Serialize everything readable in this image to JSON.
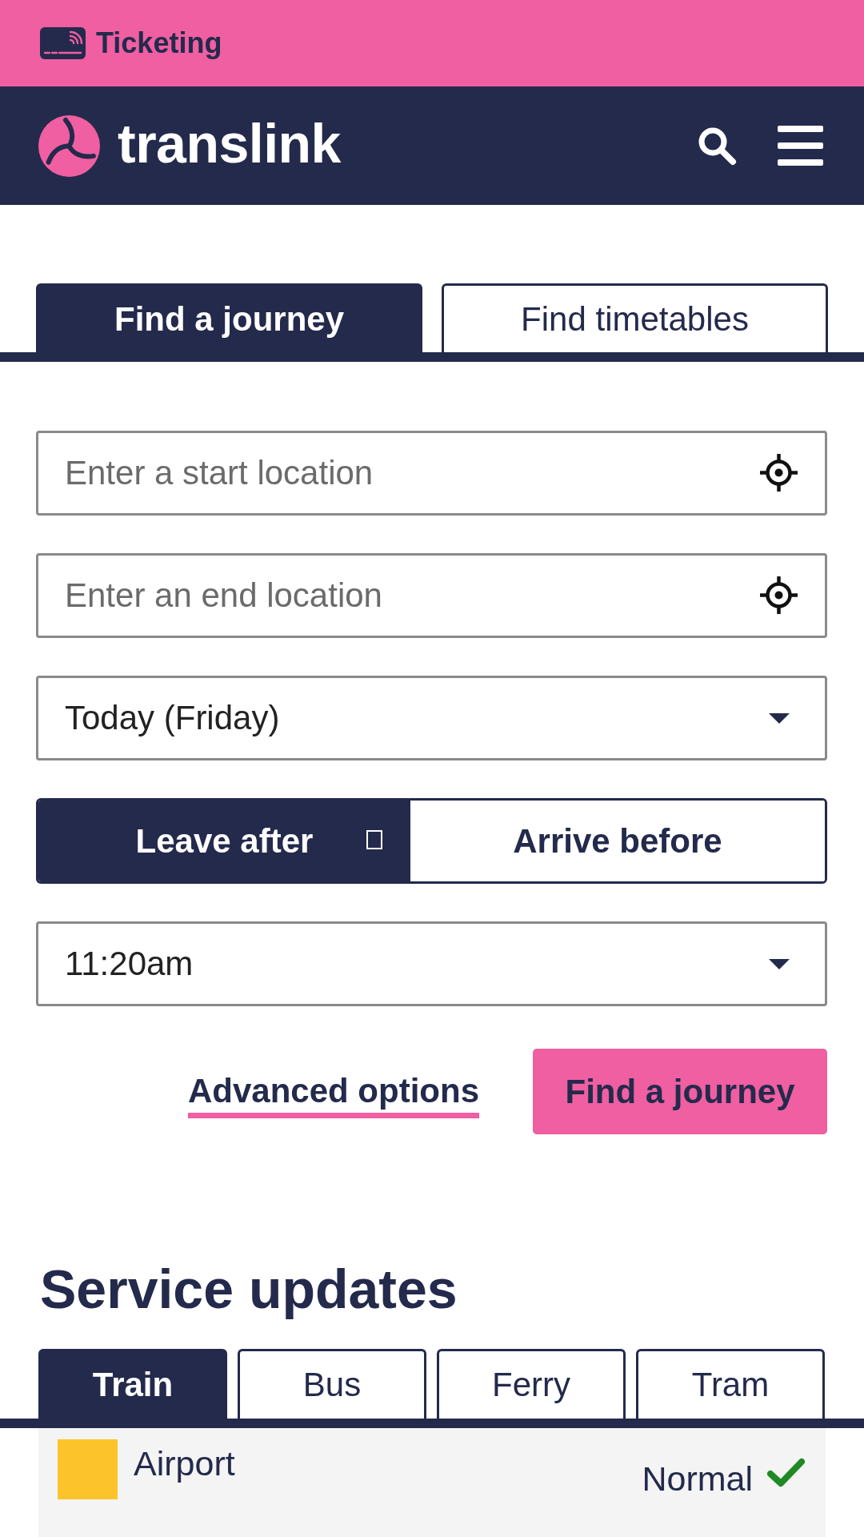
{
  "top_bar": {
    "link": "Ticketing"
  },
  "header": {
    "brand": "translink"
  },
  "journey_tabs": [
    {
      "label": "Find a journey",
      "selected": true
    },
    {
      "label": "Find timetables",
      "selected": false
    }
  ],
  "form": {
    "start": {
      "placeholder": "Enter a start location"
    },
    "end": {
      "placeholder": "Enter an end location"
    },
    "date": {
      "value": "Today (Friday)"
    },
    "time_mode": [
      {
        "label": "Leave after",
        "selected": true
      },
      {
        "label": "Arrive before",
        "selected": false
      }
    ],
    "time": {
      "value": "11:20am"
    },
    "advanced_link": "Advanced options",
    "submit": "Find a journey"
  },
  "service_updates": {
    "title": "Service updates",
    "tabs": [
      {
        "label": "Train",
        "selected": true
      },
      {
        "label": "Bus",
        "selected": false
      },
      {
        "label": "Ferry",
        "selected": false
      },
      {
        "label": "Tram",
        "selected": false
      }
    ],
    "lines": [
      {
        "name": "Airport",
        "color": "#fcc42a",
        "status": "Normal"
      }
    ]
  }
}
